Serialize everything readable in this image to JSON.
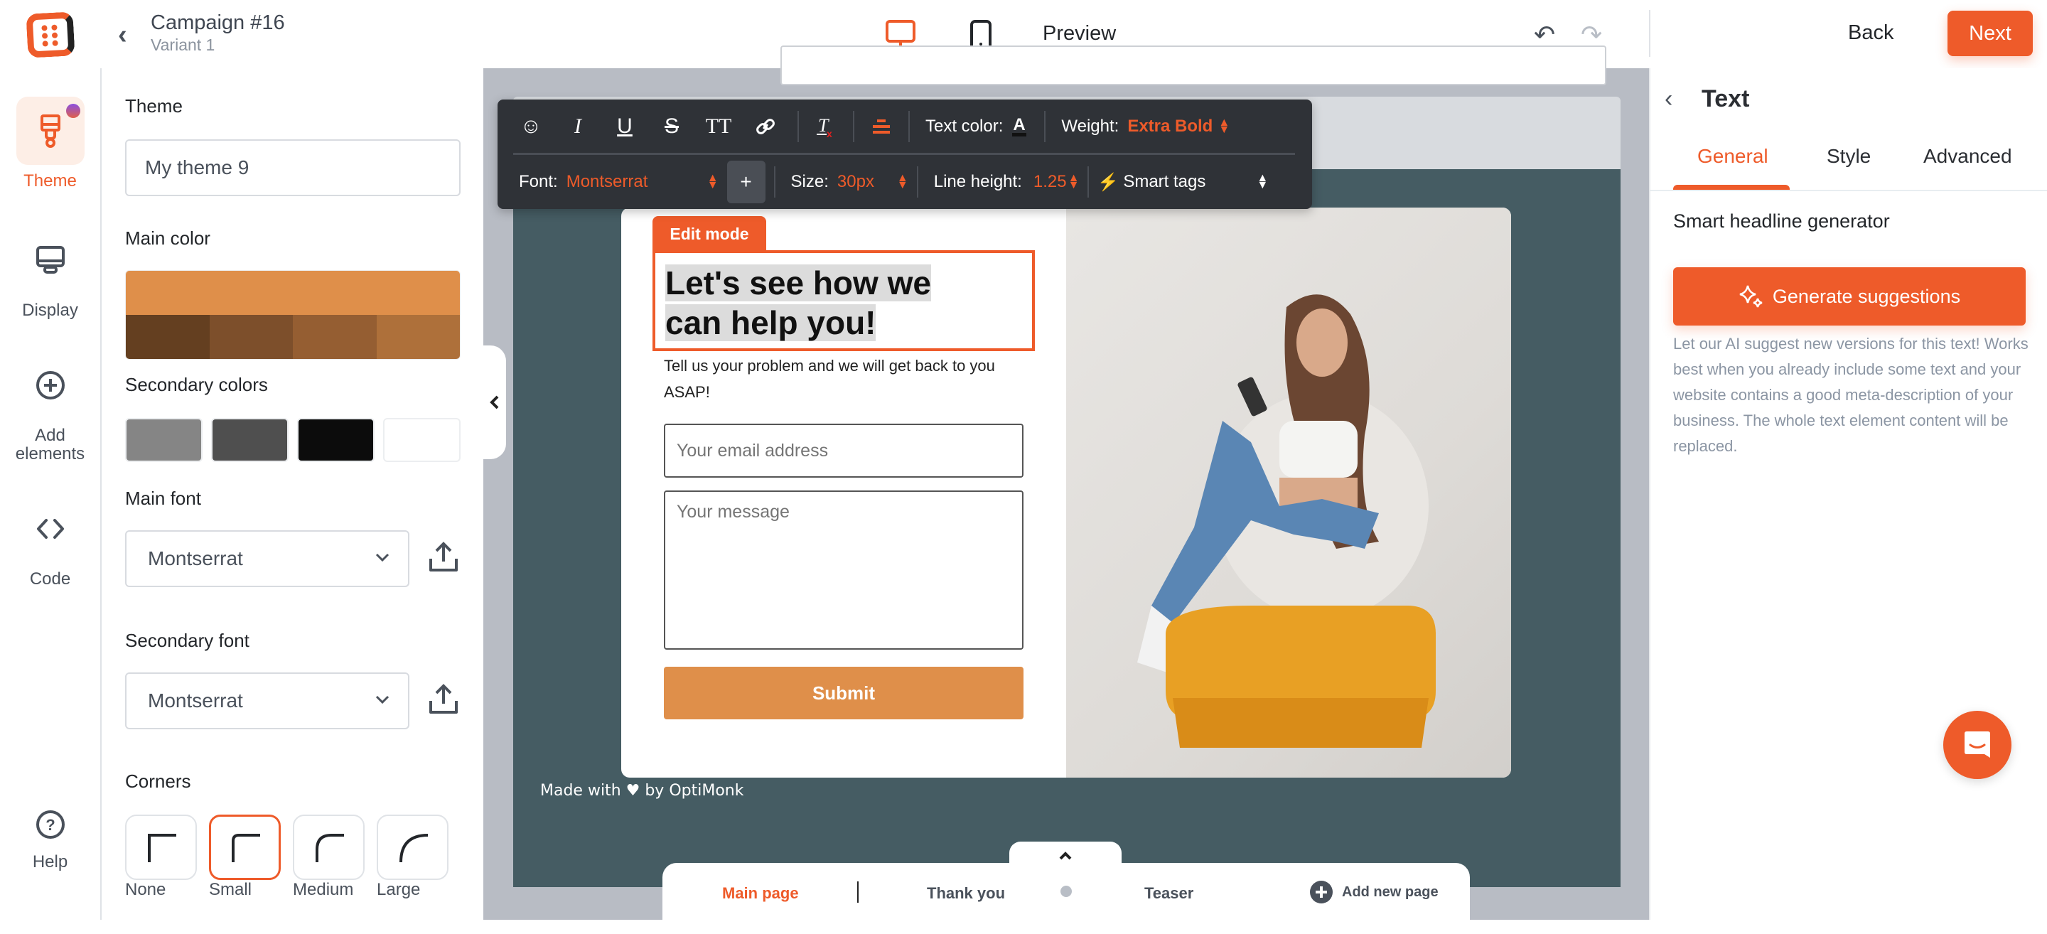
{
  "header": {
    "campaign_title": "Campaign #16",
    "variant": "Variant 1",
    "preview_label": "Preview",
    "back_label": "Back",
    "next_label": "Next",
    "active_device": "desktop"
  },
  "rail": {
    "items": [
      {
        "id": "theme",
        "label": "Theme",
        "icon": "paint-brush-icon",
        "active": true
      },
      {
        "id": "display",
        "label": "Display",
        "icon": "monitor-icon",
        "active": false
      },
      {
        "id": "add-elements",
        "label": "Add elements",
        "icon": "plus-circle-icon",
        "active": false
      },
      {
        "id": "code",
        "label": "Code",
        "icon": "code-icon",
        "active": false
      }
    ],
    "help_label": "Help"
  },
  "left_panel": {
    "theme_label": "Theme",
    "theme_name": "My theme 9",
    "main_color_label": "Main color",
    "main_color": "#DF8F4A",
    "main_color_shades": [
      "#643F20",
      "#7D4F2B",
      "#955E32",
      "#AE703A"
    ],
    "secondary_colors_label": "Secondary colors",
    "secondary_colors": [
      "#858585",
      "#4F4F4F",
      "#0C0C0C",
      "#FFFFFF"
    ],
    "main_font_label": "Main font",
    "main_font": "Montserrat",
    "secondary_font_label": "Secondary font",
    "secondary_font": "Montserrat",
    "corners_label": "Corners",
    "corners": [
      {
        "label": "None",
        "selected": false
      },
      {
        "label": "Small",
        "selected": true
      },
      {
        "label": "Medium",
        "selected": false
      },
      {
        "label": "Large",
        "selected": false
      }
    ]
  },
  "toolbar": {
    "text_color_label": "Text color:",
    "weight_label": "Weight:",
    "weight_value": "Extra Bold",
    "font_label": "Font:",
    "font_value": "Montserrat",
    "add_label": "+",
    "size_label": "Size:",
    "size_value": "30px",
    "line_height_label": "Line height:",
    "line_height_value": "1.25",
    "smart_tags_label": "Smart tags"
  },
  "popup": {
    "edit_mode_label": "Edit mode",
    "headline_line1": "Let's see how we",
    "headline_line2": "can help you!",
    "subtext": "Tell us your problem and we will get back to you ASAP!",
    "email_placeholder": "Your email address",
    "message_placeholder": "Your message",
    "submit_label": "Submit",
    "made_with": "Made with ♥ by OptiMonk"
  },
  "pages": {
    "tabs": [
      {
        "label": "Main page",
        "active": true
      },
      {
        "label": "Thank you",
        "active": false
      },
      {
        "label": "Teaser",
        "active": false
      }
    ],
    "add_new_page_label": "Add new page"
  },
  "right_panel": {
    "title": "Text",
    "tabs": [
      {
        "label": "General",
        "active": true
      },
      {
        "label": "Style",
        "active": false
      },
      {
        "label": "Advanced",
        "active": false
      }
    ],
    "section_title": "Smart headline generator",
    "generate_label": "Generate suggestions",
    "description": "Let our AI suggest new versions for this text! Works best when you already include some text and your website contains a good meta-description of your business. The whole text element content will be replaced."
  },
  "colors": {
    "accent": "#EE5B2A",
    "site_background": "#455C63"
  }
}
